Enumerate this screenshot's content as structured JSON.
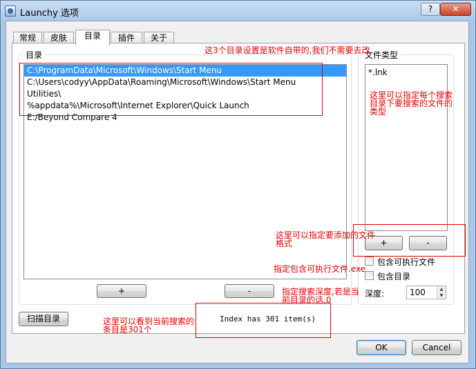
{
  "window": {
    "title": "Launchy 选项",
    "help_label": "?",
    "close_label": "✕"
  },
  "tabs": [
    {
      "label": "常规"
    },
    {
      "label": "皮肤"
    },
    {
      "label": "目录"
    },
    {
      "label": "插件"
    },
    {
      "label": "关于"
    }
  ],
  "catalog": {
    "group_label": "目录",
    "directories": [
      "C:\\ProgramData\\Microsoft\\Windows\\Start Menu",
      "C:\\Users\\codyy\\AppData\\Roaming\\Microsoft\\Windows\\Start Menu",
      "Utilities\\",
      "%appdata%\\Microsoft\\Internet Explorer\\Quick Launch",
      "E:/Beyond Compare 4"
    ],
    "add_label": "+",
    "remove_label": "-"
  },
  "filetypes": {
    "group_label": "文件类型",
    "items": [
      "*.lnk"
    ],
    "add_label": "+",
    "remove_label": "-",
    "include_exe_label": "包含可执行文件",
    "include_dirs_label": "包含目录",
    "depth_label": "深度:",
    "depth_value": "100"
  },
  "scan_label": "扫描目录",
  "status": "Index has 301 item(s)",
  "ok_label": "OK",
  "cancel_label": "Cancel",
  "annotations": {
    "dirs_note": "这3个目录设置是软件自带的,我们不需要去改",
    "types_note": "这里可以指定每个搜索目录下要搜索的文件的类型",
    "add_format_note": "这里可以指定要添加的文件格式",
    "exe_note": "指定包含可执行文件.exe",
    "depth_note": "指定搜索深度,若是当前目录的话,0",
    "count_note": "这里可以看到当前搜索的条目是301个"
  },
  "colors": {
    "selection": "#3399ff",
    "annotation": "#e00000"
  }
}
